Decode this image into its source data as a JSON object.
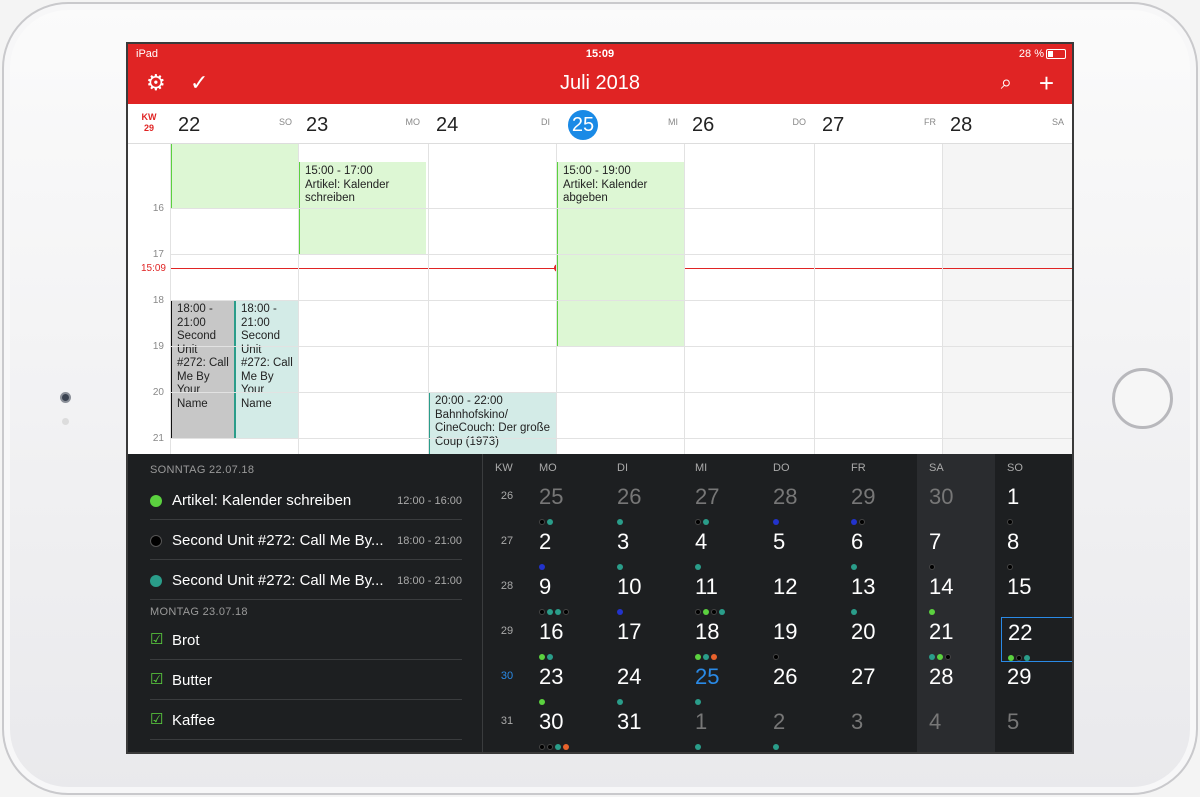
{
  "status": {
    "device": "iPad",
    "time": "15:09",
    "battery": "28 %"
  },
  "nav": {
    "title": "Juli 2018"
  },
  "week": {
    "kw_label": "KW",
    "kw_num": "29",
    "days": [
      {
        "num": "22",
        "name": "SO"
      },
      {
        "num": "23",
        "name": "MO"
      },
      {
        "num": "24",
        "name": "DI"
      },
      {
        "num": "25",
        "name": "MI"
      },
      {
        "num": "26",
        "name": "DO"
      },
      {
        "num": "27",
        "name": "FR"
      },
      {
        "num": "28",
        "name": "SA"
      }
    ],
    "now": "15:09",
    "hours": [
      "16",
      "17",
      "18",
      "19",
      "20",
      "21"
    ]
  },
  "events": [
    {
      "time": "15:00 - 17:00",
      "title": "Artikel: Kalender schreiben"
    },
    {
      "time": "15:00 - 19:00",
      "title": "Artikel: Kalender abgeben"
    },
    {
      "time": "18:00 - 21:00",
      "title": "Second Unit #272: Call Me By Your Name"
    },
    {
      "time": "18:00 - 21:00",
      "title": "Second Unit #272: Call Me By Your Name"
    },
    {
      "time": "20:00 - 22:00",
      "title": "Bahnhofskino/ CineCouch: Der große Coup (1973)"
    }
  ],
  "list": {
    "sunday_header": "SONNTAG",
    "sunday_date": "22.07.18",
    "sunday_items": [
      {
        "title": "Artikel: Kalender schreiben",
        "time": "12:00 - 16:00",
        "color": "#5bd13f"
      },
      {
        "title": "Second Unit #272: Call Me By...",
        "time": "18:00 - 21:00",
        "color": "#000000"
      },
      {
        "title": "Second Unit #272: Call Me By...",
        "time": "18:00 - 21:00",
        "color": "#2a9d8a"
      }
    ],
    "monday_header": "MONTAG",
    "monday_date": "23.07.18",
    "monday_items": [
      {
        "title": "Brot"
      },
      {
        "title": "Butter"
      },
      {
        "title": "Kaffee"
      }
    ]
  },
  "month": {
    "headers": [
      "KW",
      "MO",
      "DI",
      "MI",
      "DO",
      "FR",
      "SA",
      "SO"
    ],
    "weeks": [
      {
        "kw": "26",
        "days": [
          "25",
          "26",
          "27",
          "28",
          "29",
          "30",
          "1"
        ]
      },
      {
        "kw": "27",
        "days": [
          "2",
          "3",
          "4",
          "5",
          "6",
          "7",
          "8"
        ]
      },
      {
        "kw": "28",
        "days": [
          "9",
          "10",
          "11",
          "12",
          "13",
          "14",
          "15"
        ]
      },
      {
        "kw": "29",
        "days": [
          "16",
          "17",
          "18",
          "19",
          "20",
          "21",
          "22"
        ]
      },
      {
        "kw": "30",
        "days": [
          "23",
          "24",
          "25",
          "26",
          "27",
          "28",
          "29"
        ]
      },
      {
        "kw": "31",
        "days": [
          "30",
          "31",
          "1",
          "2",
          "3",
          "4",
          "5"
        ]
      }
    ]
  }
}
